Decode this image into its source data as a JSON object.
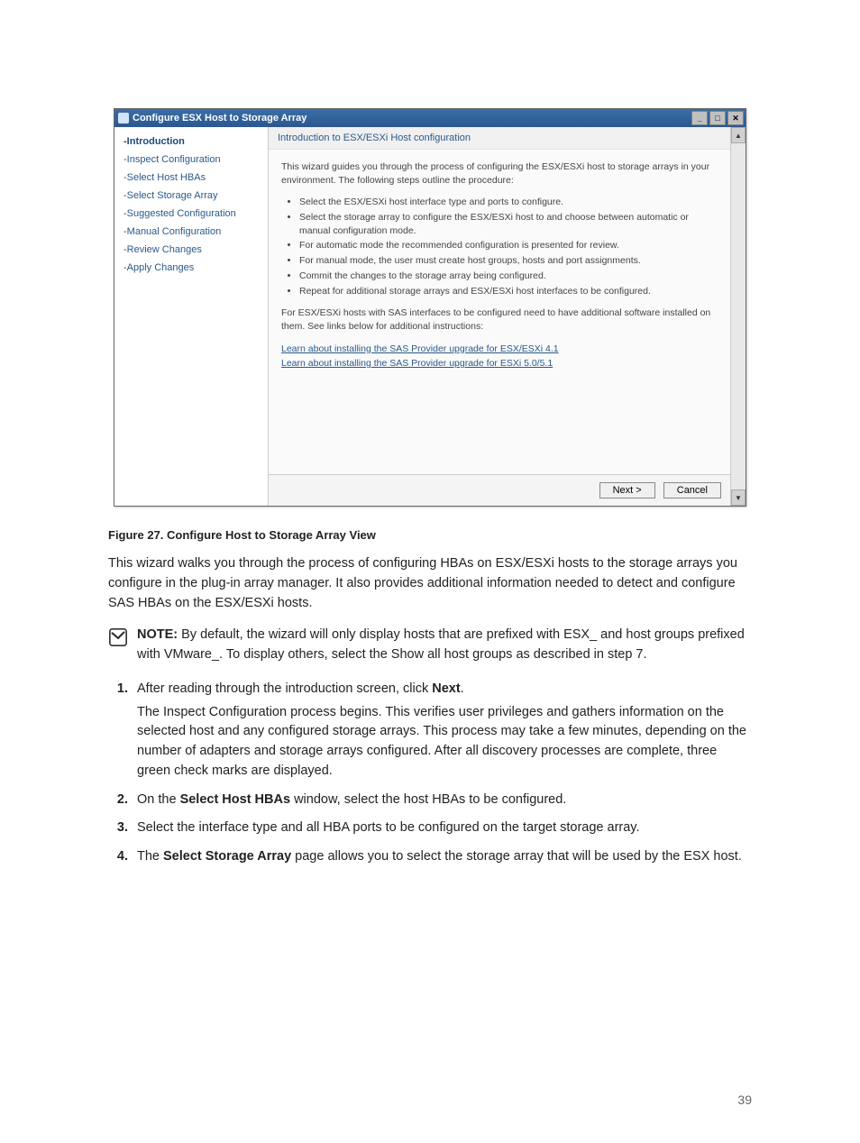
{
  "page_number": "39",
  "window": {
    "title": "Configure ESX Host to Storage Array",
    "buttons": {
      "min": "_",
      "max": "□",
      "close": "✕"
    },
    "sidebar": [
      "-Introduction",
      "-Inspect Configuration",
      "-Select Host HBAs",
      "-Select Storage Array",
      "-Suggested Configuration",
      "-Manual Configuration",
      "-Review Changes",
      "-Apply Changes"
    ],
    "content_header": "Introduction to ESX/ESXi Host configuration",
    "intro_para": "This wizard guides you through the process of configuring the ESX/ESXi host to storage arrays in your environment. The following steps outline the procedure:",
    "bullets": [
      "Select the ESX/ESXi host interface type and ports to configure.",
      "Select the storage array to configure the ESX/ESXi host to and choose between automatic or manual configuration mode.",
      "For automatic mode the recommended configuration is presented for review.",
      "For manual mode, the user must create host groups, hosts and port assignments.",
      "Commit the changes to the storage array being configured.",
      "Repeat for additional storage arrays and ESX/ESXi host interfaces to be configured."
    ],
    "sas_para": "For ESX/ESXi hosts with SAS interfaces to be configured need to have additional software installed on them. See links below for additional instructions:",
    "links": [
      "Learn about installing the SAS Provider upgrade for ESX/ESXi 4.1",
      "Learn about installing the SAS Provider upgrade for ESXi 5.0/5.1"
    ],
    "next_btn": "Next >",
    "cancel_btn": "Cancel"
  },
  "caption": "Figure 27. Configure Host to Storage Array View",
  "body_para": "This wizard walks you through the process of configuring HBAs on ESX/ESXi hosts to the storage arrays you configure in the plug-in array manager. It also provides additional information needed to detect and configure SAS HBAs on the ESX/ESXi hosts.",
  "note": {
    "label": "NOTE:",
    "text": " By default, the wizard will only display hosts that are prefixed with ESX_ and host groups prefixed with VMware_. To display others, select the Show all host groups as described in step 7."
  },
  "steps": [
    {
      "lead": "After reading through the introduction screen, click ",
      "bold1": "Next",
      "tail": ".",
      "extra": "The Inspect Configuration process begins. This verifies user privileges and gathers information on the selected host and any configured storage arrays. This process may take a few minutes, depending on the number of adapters and storage arrays configured. After all discovery processes are complete, three green check marks are displayed."
    },
    {
      "lead": "On the ",
      "bold1": "Select Host HBAs",
      "tail": " window, select the host HBAs to be configured."
    },
    {
      "lead": "Select the interface type and all HBA ports to be configured on the target storage array.",
      "bold1": "",
      "tail": ""
    },
    {
      "lead": "The ",
      "bold1": "Select Storage Array",
      "tail": " page allows you to select the storage array that will be used by the ESX host."
    }
  ]
}
